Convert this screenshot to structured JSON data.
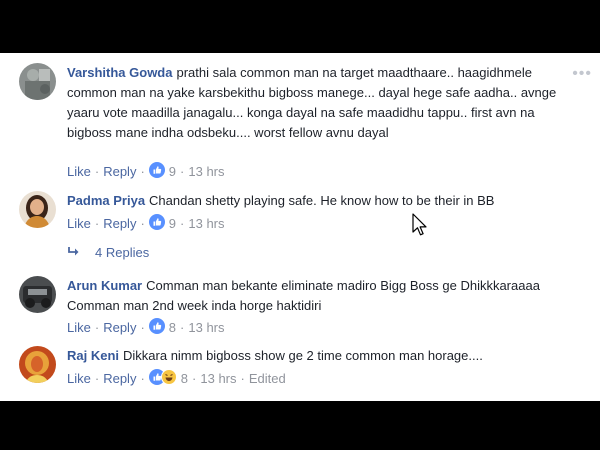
{
  "comments": [
    {
      "author": "Varshitha Gowda",
      "text": "prathi sala common man na target maadthaare.. haagidhmele common man na yake karsbekithu bigboss manege... dayal hege safe aadha.. avnge yaaru vote maadilla janagalu... konga dayal na safe maadidhu tappu.. first avn na bigboss mane indha odsbeku.... worst fellow avnu dayal",
      "like": "Like",
      "reply": "Reply",
      "reactions": "9",
      "time": "13 hrs",
      "avatar_icon": "grey-photo-avatar"
    },
    {
      "author": "Padma Priya",
      "text": "Chandan shetty playing safe. He know how to be their in BB",
      "like": "Like",
      "reply": "Reply",
      "reactions": "9",
      "time": "13 hrs",
      "avatar_icon": "woman-photo-avatar"
    },
    {
      "author": "Arun Kumar",
      "text": "Comman man bekante eliminate madiro Bigg Boss ge Dhikkkaraaaa Comman man 2nd week inda horge haktidiri",
      "like": "Like",
      "reply": "Reply",
      "reactions": "8",
      "time": "13 hrs",
      "avatar_icon": "dark-photo-avatar"
    },
    {
      "author": "Raj Keni",
      "text": "Dikkara nimm bigboss show ge 2 time common man horage....",
      "like": "Like",
      "reply": "Reply",
      "reactions": "8",
      "time": "13 hrs",
      "edited": "Edited",
      "avatar_icon": "deity-photo-avatar"
    }
  ],
  "replies_link": "4 Replies",
  "more_icon": "more-options-icon",
  "colors": {
    "author": "#365899",
    "link": "#4b67a1",
    "meta": "#90949c",
    "text": "#1d2129",
    "like_badge": "#5890ff"
  }
}
